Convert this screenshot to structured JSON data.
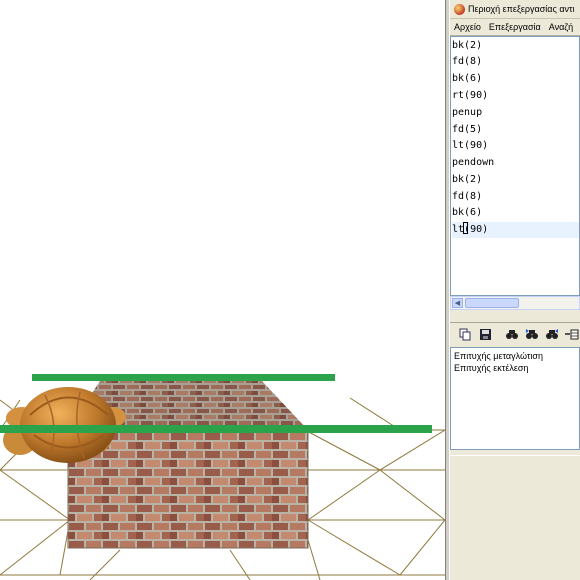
{
  "window": {
    "title": "Περιοχή επεξεργασίας αντι"
  },
  "menu": [
    {
      "label": "Αρχείο"
    },
    {
      "label": "Επεξεργασία"
    },
    {
      "label": "Αναζή"
    }
  ],
  "editor": {
    "lines": [
      "bk(2)",
      "fd(8)",
      "bk(6)",
      "rt(90)",
      "penup",
      "fd(5)",
      "lt(90)",
      "pendown",
      "bk(2)",
      "fd(8)",
      "bk(6)"
    ],
    "current_line": {
      "before_caret": "lt",
      "after_caret": "(90)"
    }
  },
  "toolbar": {
    "icons": [
      "copy-icon",
      "save-icon",
      "find-icon",
      "find-previous-icon",
      "find-next-icon",
      "insert-row-icon"
    ]
  },
  "messages": [
    "Επιτυχής μεταγλώτιση",
    "Επιτυχής εκτέλεση"
  ],
  "colors": {
    "turtle_trail": "#2aa34a",
    "grid_lines": "#8f7a3c",
    "panel_background": "#ece9d8",
    "active_line_highlight": "#e8f2fe"
  }
}
